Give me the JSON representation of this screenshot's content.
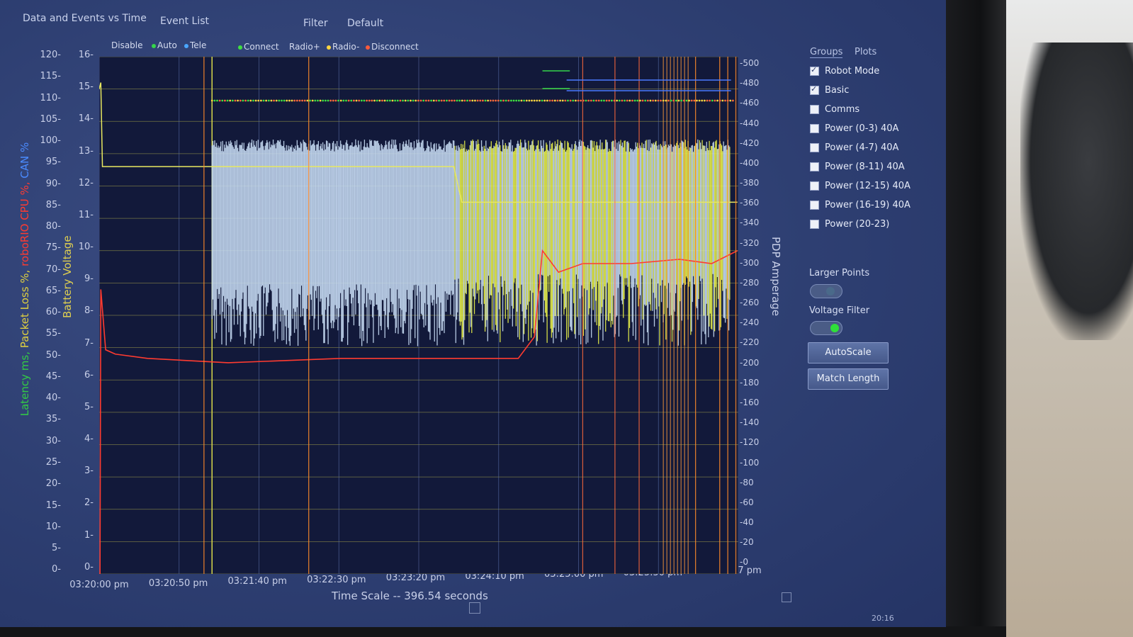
{
  "menu": {
    "title": "Data and Events vs Time",
    "event_list": "Event List",
    "filter": "Filter",
    "default": "Default"
  },
  "legend": {
    "disable": "Disable",
    "auto": "Auto",
    "tele": "Tele",
    "connect": "Connect",
    "radio_plus": "Radio+",
    "radio_minus": "Radio-",
    "disconnect": "Disconnect"
  },
  "colors": {
    "auto": "#35d64a",
    "tele": "#4aa6ff",
    "connect": "#40e040",
    "radio_plus": "#ffd640",
    "disconnect": "#ff5a3a",
    "voltage": "#e8e860",
    "cpu": "#ff3b30",
    "amps": "#c7dcf4",
    "event": "#ff8a2a"
  },
  "left_axis": {
    "ticks": [
      "120-",
      "115-",
      "110-",
      "105-",
      "100-",
      "95-",
      "90-",
      "85-",
      "80-",
      "75-",
      "70-",
      "65-",
      "60-",
      "55-",
      "50-",
      "45-",
      "40-",
      "35-",
      "30-",
      "25-",
      "20-",
      "15-",
      "10-",
      "5-",
      "0-"
    ],
    "label_parts": [
      {
        "text": "Latency ms, ",
        "color": "#33cc44"
      },
      {
        "text": "Packet Loss %, ",
        "color": "#e0d040"
      },
      {
        "text": "roboRIO CPU %, ",
        "color": "#ff3b30"
      },
      {
        "text": "CAN %",
        "color": "#4a8bff"
      }
    ]
  },
  "voltage_axis": {
    "ticks": [
      "16-",
      "15-",
      "14-",
      "13-",
      "12-",
      "11-",
      "10-",
      "9-",
      "8-",
      "7-",
      "6-",
      "5-",
      "4-",
      "3-",
      "2-",
      "1-",
      "0-"
    ],
    "label": "Battery Voltage"
  },
  "right_axis": {
    "ticks": [
      "-500",
      "-480",
      "-460",
      "-440",
      "-420",
      "-400",
      "-380",
      "-360",
      "-340",
      "-320",
      "-300",
      "-280",
      "-260",
      "-240",
      "-220",
      "-200",
      "-180",
      "-160",
      "-140",
      "-120",
      "-100",
      "-80",
      "-60",
      "-40",
      "-20",
      "-0"
    ],
    "label": "PDP Amperage"
  },
  "x_axis": {
    "ticks": [
      "03:20:00 pm",
      "03:20:50 pm",
      "03:21:40 pm",
      "03:22:30 pm",
      "03:23:20 pm",
      "03:24:10 pm",
      "03:25:00 pm",
      "03:25:50 pm",
      "03:26:37 pm"
    ],
    "time_scale": "Time Scale -- 396.54 seconds"
  },
  "sidebar": {
    "tabs": [
      "Groups",
      "Plots"
    ],
    "groups": [
      {
        "label": "Robot Mode",
        "checked": true
      },
      {
        "label": "Basic",
        "checked": true
      },
      {
        "label": "Comms",
        "checked": false
      },
      {
        "label": "Power (0-3) 40A",
        "checked": false
      },
      {
        "label": "Power (4-7) 40A",
        "checked": false
      },
      {
        "label": "Power (8-11) 40A",
        "checked": false
      },
      {
        "label": "Power (12-15) 40A",
        "checked": false
      },
      {
        "label": "Power (16-19) 40A",
        "checked": false
      },
      {
        "label": "Power (20-23)",
        "checked": false
      }
    ],
    "larger_points": {
      "label": "Larger Points",
      "on": false
    },
    "voltage_filter": {
      "label": "Voltage Filter",
      "on": true
    },
    "autoscale": "AutoScale",
    "match_length": "Match Length"
  },
  "taskbar_time": "20:16",
  "chart_data": {
    "type": "line",
    "x_range_seconds": [
      0,
      396.54
    ],
    "left_ylim": [
      0,
      120
    ],
    "voltage_ylim": [
      0,
      16
    ],
    "amps_ylim": [
      0,
      500
    ],
    "series": [
      {
        "name": "roboRIO CPU %",
        "axis": "left",
        "points": [
          [
            0,
            0
          ],
          [
            0.5,
            0
          ],
          [
            1,
            66
          ],
          [
            4,
            52
          ],
          [
            10,
            51
          ],
          [
            30,
            50
          ],
          [
            80,
            49
          ],
          [
            150,
            50
          ],
          [
            230,
            50
          ],
          [
            260,
            50
          ],
          [
            270,
            55
          ],
          [
            275,
            75
          ],
          [
            285,
            70
          ],
          [
            300,
            72
          ],
          [
            330,
            72
          ],
          [
            360,
            73
          ],
          [
            380,
            72
          ],
          [
            396,
            75
          ]
        ]
      },
      {
        "name": "Battery Voltage",
        "axis": "voltage",
        "points": [
          [
            0,
            15
          ],
          [
            1,
            15.2
          ],
          [
            2,
            12.6
          ],
          [
            220,
            12.6
          ],
          [
            225,
            11.5
          ],
          [
            396,
            11.5
          ]
        ]
      },
      {
        "name": "PDP Amperage",
        "axis": "amps",
        "points": [
          [
            70,
            420
          ],
          [
            220,
            415
          ],
          [
            396,
            410
          ]
        ]
      }
    ],
    "event_lines_seconds": [
      65,
      130,
      370,
      385,
      390,
      395
    ]
  }
}
